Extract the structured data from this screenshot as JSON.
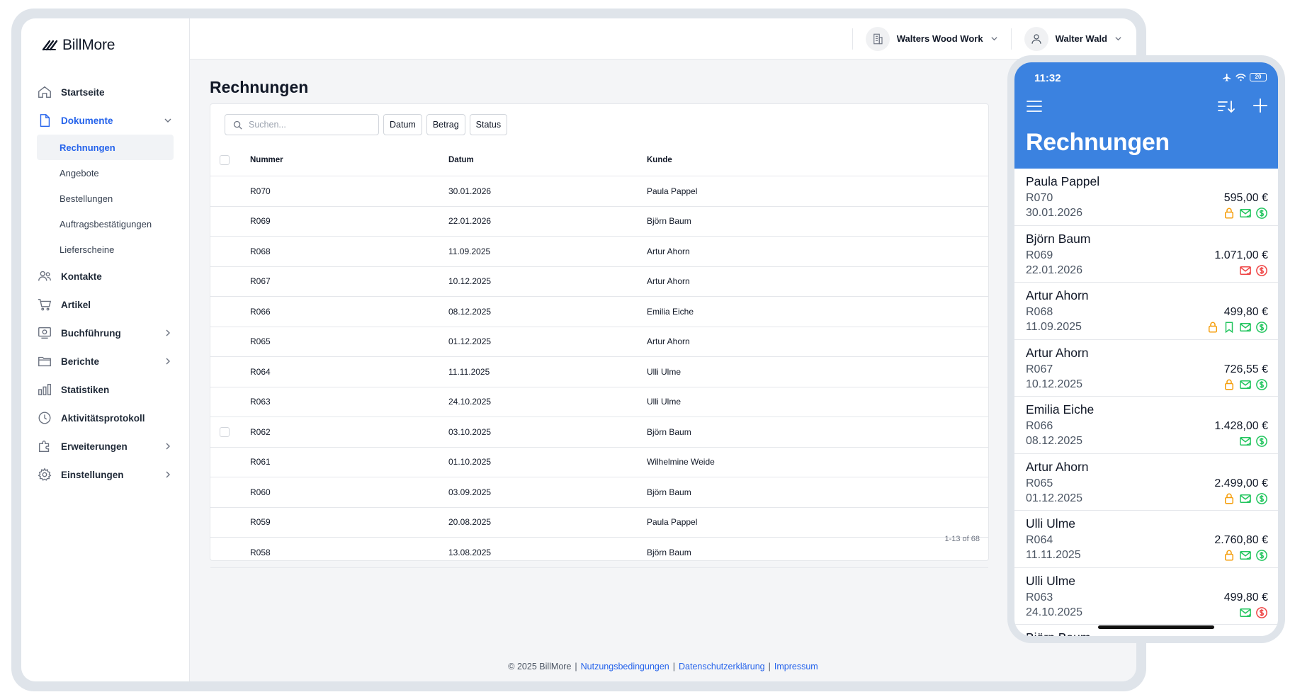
{
  "app": {
    "brand": "BillMore"
  },
  "topbar": {
    "company": "Walters Wood Work",
    "user": "Walter Wald"
  },
  "sidebar": {
    "items": [
      {
        "label": "Startseite"
      },
      {
        "label": "Dokumente"
      },
      {
        "label": "Kontakte"
      },
      {
        "label": "Artikel"
      },
      {
        "label": "Buchführung"
      },
      {
        "label": "Berichte"
      },
      {
        "label": "Statistiken"
      },
      {
        "label": "Aktivitätsprotokoll"
      },
      {
        "label": "Erweiterungen"
      },
      {
        "label": "Einstellungen"
      }
    ],
    "documents_sub": [
      "Rechnungen",
      "Angebote",
      "Bestellungen",
      "Auftragsbestätigungen",
      "Lieferscheine"
    ]
  },
  "page": {
    "title": "Rechnungen"
  },
  "search": {
    "placeholder": "Suchen..."
  },
  "filters": [
    "Datum",
    "Betrag",
    "Status"
  ],
  "table": {
    "headers": [
      "Nummer",
      "Datum",
      "Kunde"
    ],
    "rows": [
      {
        "num": "R070",
        "date": "30.01.2026",
        "customer": "Paula Pappel"
      },
      {
        "num": "R069",
        "date": "22.01.2026",
        "customer": "Björn Baum"
      },
      {
        "num": "R068",
        "date": "11.09.2025",
        "customer": "Artur Ahorn"
      },
      {
        "num": "R067",
        "date": "10.12.2025",
        "customer": "Artur Ahorn"
      },
      {
        "num": "R066",
        "date": "08.12.2025",
        "customer": "Emilia Eiche"
      },
      {
        "num": "R065",
        "date": "01.12.2025",
        "customer": "Artur Ahorn"
      },
      {
        "num": "R064",
        "date": "11.11.2025",
        "customer": "Ulli Ulme"
      },
      {
        "num": "R063",
        "date": "24.10.2025",
        "customer": "Ulli Ulme"
      },
      {
        "num": "R062",
        "date": "03.10.2025",
        "customer": "Björn Baum"
      },
      {
        "num": "R061",
        "date": "01.10.2025",
        "customer": "Wilhelmine Weide"
      },
      {
        "num": "R060",
        "date": "03.09.2025",
        "customer": "Björn Baum"
      },
      {
        "num": "R059",
        "date": "20.08.2025",
        "customer": "Paula Pappel"
      },
      {
        "num": "R058",
        "date": "13.08.2025",
        "customer": "Björn Baum"
      }
    ],
    "pagination": "1-13 of 68"
  },
  "footer": {
    "copyright": "© 2025 BillMore",
    "links": [
      "Nutzungsbedingungen",
      "Datenschutzerklärung",
      "Impressum"
    ]
  },
  "phone": {
    "time": "11:32",
    "battery": "20",
    "title": "Rechnungen",
    "items": [
      {
        "name": "Paula Pappel",
        "num": "R070",
        "amount": "595,00 €",
        "date": "30.01.2026",
        "icons": [
          "lock-icon",
          "mail-icon",
          "dollar-icon"
        ],
        "colors": [
          "#f59e0b",
          "#22c55e",
          "#22c55e"
        ]
      },
      {
        "name": "Björn Baum",
        "num": "R069",
        "amount": "1.071,00 €",
        "date": "22.01.2026",
        "icons": [
          "mail-icon",
          "dollar-icon"
        ],
        "colors": [
          "#ef4444",
          "#ef4444"
        ]
      },
      {
        "name": "Artur Ahorn",
        "num": "R068",
        "amount": "499,80 €",
        "date": "11.09.2025",
        "icons": [
          "lock-icon",
          "bookmark-icon",
          "mail-icon",
          "dollar-icon"
        ],
        "colors": [
          "#f59e0b",
          "#22c55e",
          "#22c55e",
          "#22c55e"
        ]
      },
      {
        "name": "Artur Ahorn",
        "num": "R067",
        "amount": "726,55 €",
        "date": "10.12.2025",
        "icons": [
          "lock-icon",
          "mail-icon",
          "dollar-icon"
        ],
        "colors": [
          "#f59e0b",
          "#22c55e",
          "#22c55e"
        ]
      },
      {
        "name": "Emilia Eiche",
        "num": "R066",
        "amount": "1.428,00 €",
        "date": "08.12.2025",
        "icons": [
          "mail-icon",
          "dollar-icon"
        ],
        "colors": [
          "#22c55e",
          "#22c55e"
        ]
      },
      {
        "name": "Artur Ahorn",
        "num": "R065",
        "amount": "2.499,00 €",
        "date": "01.12.2025",
        "icons": [
          "lock-icon",
          "mail-icon",
          "dollar-icon"
        ],
        "colors": [
          "#f59e0b",
          "#22c55e",
          "#22c55e"
        ]
      },
      {
        "name": "Ulli Ulme",
        "num": "R064",
        "amount": "2.760,80 €",
        "date": "11.11.2025",
        "icons": [
          "lock-icon",
          "mail-icon",
          "dollar-icon"
        ],
        "colors": [
          "#f59e0b",
          "#22c55e",
          "#22c55e"
        ]
      },
      {
        "name": "Ulli Ulme",
        "num": "R063",
        "amount": "499,80 €",
        "date": "24.10.2025",
        "icons": [
          "mail-icon",
          "dollar-icon"
        ],
        "colors": [
          "#22c55e",
          "#ef4444"
        ]
      },
      {
        "name": "Björn Baum",
        "num": "",
        "amount": "",
        "date": "",
        "icons": [],
        "colors": []
      }
    ]
  },
  "colors": {
    "accent": "#2563eb",
    "phone_header": "#3b82e0",
    "ok": "#22c55e",
    "warn": "#f59e0b",
    "danger": "#ef4444"
  }
}
